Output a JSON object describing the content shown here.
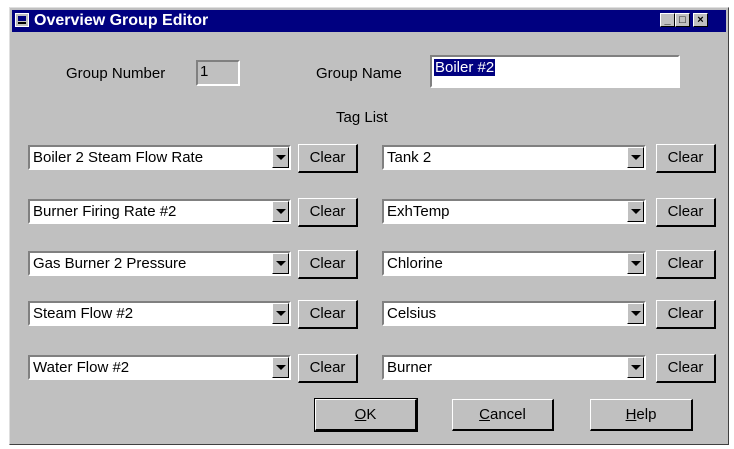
{
  "window": {
    "title": "Overview Group Editor",
    "title_bg": "#000080",
    "face_color": "#c0c0c0"
  },
  "group": {
    "number_label": "Group Number",
    "number_value": "1",
    "name_label": "Group Name",
    "name_value": "Boiler #2"
  },
  "tag_list": {
    "label": "Tag List",
    "clear_label": "Clear",
    "left": [
      "Boiler 2 Steam Flow Rate",
      "Burner Firing Rate #2",
      "Gas Burner 2 Pressure",
      "Steam Flow #2",
      "Water Flow #2"
    ],
    "right": [
      "Tank 2",
      "ExhTemp",
      "Chlorine",
      "Celsius",
      "Burner"
    ]
  },
  "buttons": {
    "ok": {
      "mnemonic": "O",
      "rest": "K"
    },
    "cancel": {
      "mnemonic": "C",
      "rest": "ancel"
    },
    "help": {
      "mnemonic": "H",
      "rest": "elp"
    }
  },
  "icons": {
    "title": "app-icon",
    "minimize": "minimize-icon",
    "maximize": "maximize-icon",
    "close": "close-icon",
    "dropdown": "chevron-down-icon"
  }
}
